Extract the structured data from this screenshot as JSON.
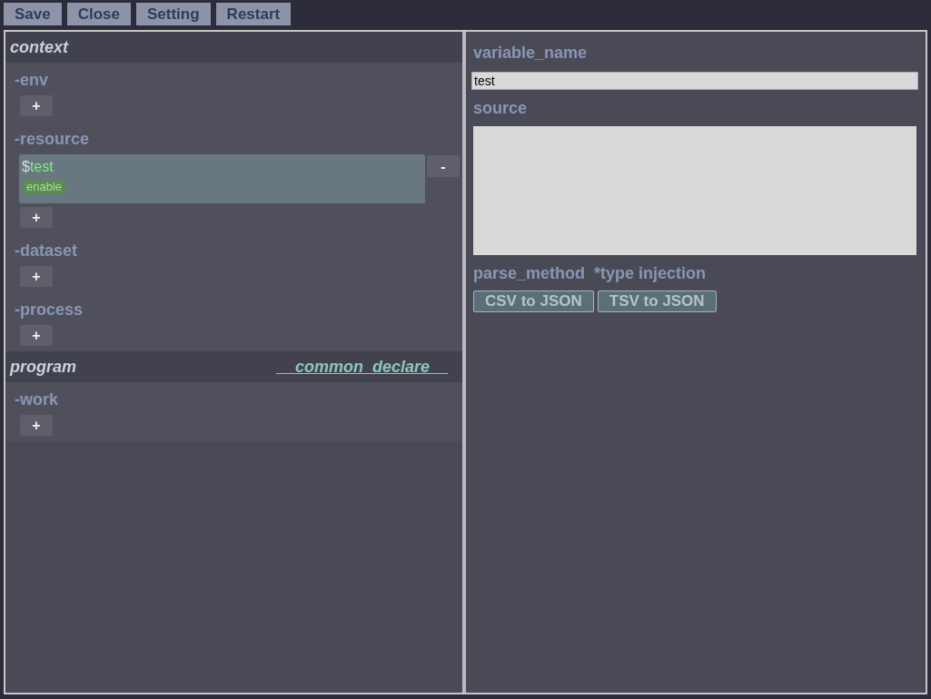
{
  "toolbar": {
    "buttons": [
      "Save",
      "Close",
      "Setting",
      "Restart"
    ]
  },
  "tree": {
    "groups": [
      {
        "title": "context",
        "sections": [
          {
            "label": "-env",
            "add_button": "+"
          },
          {
            "label": "-resource",
            "items": [
              {
                "prefix": "$",
                "name": "test",
                "badge": "enable",
                "remove_button": "-",
                "selected": true
              }
            ],
            "add_button": "+"
          },
          {
            "label": "-dataset",
            "add_button": "+"
          },
          {
            "label": "-process",
            "add_button": "+"
          }
        ]
      },
      {
        "title": "program",
        "link": "__common_declare__",
        "sections": [
          {
            "label": "-work",
            "add_button": "+"
          }
        ]
      }
    ]
  },
  "editor": {
    "variable_name": {
      "label": "variable_name",
      "value": "test"
    },
    "source": {
      "label": "source"
    },
    "parse_method": {
      "label": "parse_method",
      "note": "*type injection",
      "buttons": [
        "CSV to JSON",
        "TSV to JSON"
      ]
    }
  }
}
